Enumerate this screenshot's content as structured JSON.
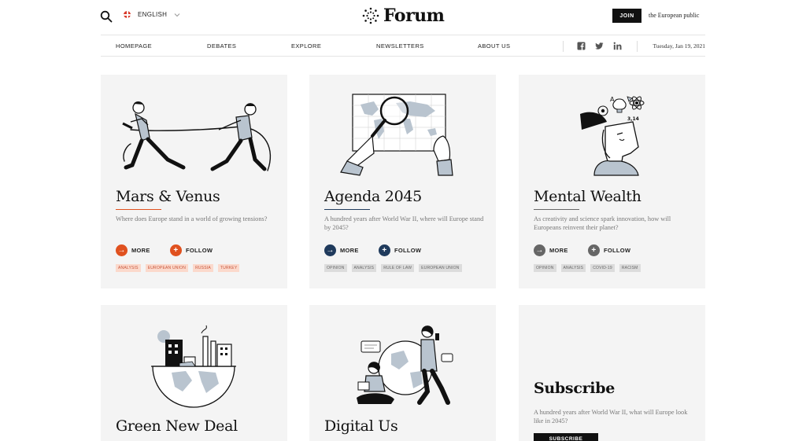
{
  "header": {
    "logo_text": "Forum",
    "language": "ENGLISH",
    "join_label": "JOIN",
    "tagline": "the European public"
  },
  "nav": {
    "items": [
      "HOMEPAGE",
      "DEBATES",
      "EXPLORE",
      "NEWSLETTERS",
      "ABOUT US"
    ],
    "date": "Tuesday, Jan 19, 2021",
    "social_icons": [
      "facebook-icon",
      "twitter-icon",
      "linkedin-icon"
    ]
  },
  "cards": [
    {
      "title": "Mars & Venus",
      "description": "Where does Europe stand in a world of growing tensions?",
      "accent": "#e0511f",
      "more_label": "MORE",
      "follow_label": "FOLLOW",
      "tags": [
        "ANALYSIS",
        "EUROPEAN UNION",
        "RUSSIA",
        "TURKEY"
      ]
    },
    {
      "title": "Agenda 2045",
      "description": "A hundred years after World War II, where will Europe stand by 2045?",
      "accent": "#1f3a5c",
      "more_label": "MORE",
      "follow_label": "FOLLOW",
      "tags": [
        "OPINION",
        "ANALYSIS",
        "RULE OF LAW",
        "EUROPEAN UNION"
      ]
    },
    {
      "title": "Mental Wealth",
      "description": "As creativity and science spark innovation, how will Europeans reinvent their planet?",
      "accent": "#666666",
      "more_label": "MORE",
      "follow_label": "FOLLOW",
      "tags": [
        "OPINION",
        "ANALYSIS",
        "COVID-19",
        "RACISM"
      ]
    },
    {
      "title": "Green New Deal"
    },
    {
      "title": "Digital Us"
    },
    {
      "title": "Subscribe",
      "description": "A hundred years after World War II, what will Europe look like in 2045?",
      "button_label": "SUBSCRIBE"
    }
  ]
}
